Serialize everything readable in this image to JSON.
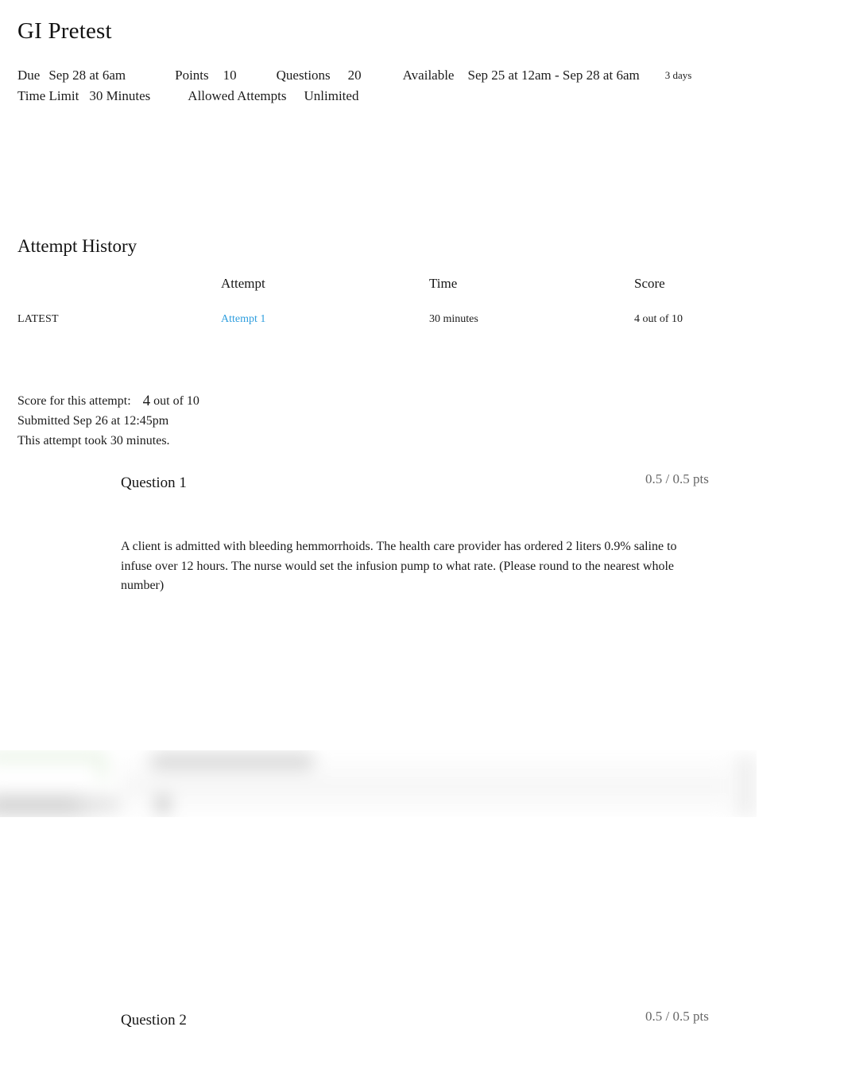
{
  "quiz": {
    "title": "GI Pretest",
    "meta": {
      "due_label": "Due",
      "due_value": "Sep 28 at 6am",
      "points_label": "Points",
      "points_value": "10",
      "questions_label": "Questions",
      "questions_value": "20",
      "available_label": "Available",
      "available_value": "Sep 25 at 12am - Sep 28 at 6am",
      "available_duration": "3 days",
      "time_limit_label": "Time Limit",
      "time_limit_value": "30 Minutes",
      "allowed_attempts_label": "Allowed Attempts",
      "allowed_attempts_value": "Unlimited"
    }
  },
  "attempt_history": {
    "heading": "Attempt History",
    "columns": {
      "blank": "",
      "attempt": "Attempt",
      "time": "Time",
      "score": "Score"
    },
    "rows": [
      {
        "badge": "LATEST",
        "attempt": "Attempt 1",
        "time": "30 minutes",
        "score": "4 out of 10"
      }
    ],
    "link_color": "#2f9ede"
  },
  "score_summary": {
    "score_label": "Score for this attempt:",
    "score_value": "4",
    "score_out_of": "out of 10",
    "submitted": "Submitted Sep 26 at 12:45pm",
    "duration": "This attempt took 30 minutes."
  },
  "questions": [
    {
      "name": "Question 1",
      "points": "0.5 / 0.5 pts",
      "text": "A client is admitted with bleeding hemmorrhoids. The health care provider has ordered 2 liters 0.9% saline to infuse over 12 hours. The nurse would set the infusion pump to what rate. (Please round to the nearest whole number)"
    },
    {
      "name": "Question 2",
      "points": "0.5 / 0.5 pts",
      "text": ""
    }
  ],
  "redacted_region": {
    "description": "blurred answer area",
    "correct_highlight_color": "#d9ead3"
  }
}
